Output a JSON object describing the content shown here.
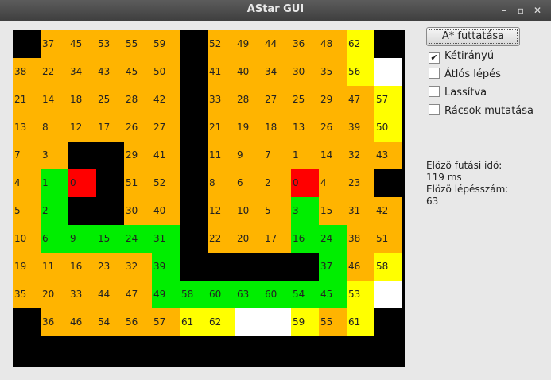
{
  "window": {
    "title": "AStar GUI",
    "buttons": {
      "minimize": "–",
      "maximize": "▫",
      "close": "✕"
    }
  },
  "controls": {
    "run_label": "A* futtatása",
    "options": [
      {
        "label": "Kétirányú",
        "checked": true
      },
      {
        "label": "Átlós lépés",
        "checked": false
      },
      {
        "label": "Lassítva",
        "checked": false
      },
      {
        "label": "Rácsok mutatása",
        "checked": false
      }
    ]
  },
  "info": {
    "time_label": "Elözö futási idö:",
    "time_value": "119 ms",
    "steps_label": "Elözö lépésszám:",
    "steps_value": "63"
  },
  "colors": {
    "wall": "#000000",
    "closed": "#ffb400",
    "open": "#ffff00",
    "path": "#00ee00",
    "endpoint": "#ff0000",
    "empty": "#ffffff"
  },
  "grid": {
    "legend": "K=wall O=closed Y=open G=path R=endpoint W=empty",
    "rows": [
      {
        "types": "KOOOOOKOOOOOYK",
        "values": [
          "",
          "37",
          "45",
          "53",
          "55",
          "59",
          "",
          "52",
          "49",
          "44",
          "36",
          "48",
          "62",
          ""
        ]
      },
      {
        "types": "OOOOOOKOOOOOYW",
        "values": [
          "38",
          "22",
          "34",
          "43",
          "45",
          "50",
          "",
          "41",
          "40",
          "34",
          "30",
          "35",
          "56",
          ""
        ]
      },
      {
        "types": "OOOOOOKOOOOOOY",
        "values": [
          "21",
          "14",
          "18",
          "25",
          "28",
          "42",
          "",
          "33",
          "28",
          "27",
          "25",
          "29",
          "47",
          "57"
        ]
      },
      {
        "types": "OOOOOOKOOOOOOY",
        "values": [
          "13",
          "8",
          "12",
          "17",
          "26",
          "27",
          "",
          "21",
          "19",
          "18",
          "13",
          "26",
          "39",
          "50"
        ]
      },
      {
        "types": "OOKKOOKOOOOOOO",
        "values": [
          "7",
          "3",
          "",
          "",
          "29",
          "41",
          "",
          "11",
          "9",
          "7",
          "1",
          "14",
          "32",
          "43"
        ]
      },
      {
        "types": "OGRKOOKOOOROOK",
        "values": [
          "4",
          "1",
          "0",
          "",
          "51",
          "52",
          "",
          "8",
          "6",
          "2",
          "0",
          "4",
          "23",
          ""
        ]
      },
      {
        "types": "OGKKOOKOOOGOOO",
        "values": [
          "5",
          "2",
          "",
          "",
          "30",
          "40",
          "",
          "12",
          "10",
          "5",
          "3",
          "15",
          "31",
          "42"
        ]
      },
      {
        "types": "OGGGGGKOOOGGOO",
        "values": [
          "10",
          "6",
          "9",
          "15",
          "24",
          "31",
          "",
          "22",
          "20",
          "17",
          "16",
          "24",
          "38",
          "51"
        ]
      },
      {
        "types": "OOOOOGKKKKKGOY",
        "values": [
          "19",
          "11",
          "16",
          "23",
          "32",
          "39",
          "",
          "",
          "",
          "",
          "",
          "37",
          "46",
          "58"
        ]
      },
      {
        "types": "OOOOOGGGGGGGYW",
        "values": [
          "35",
          "20",
          "33",
          "44",
          "47",
          "49",
          "58",
          "60",
          "63",
          "60",
          "54",
          "45",
          "53",
          ""
        ]
      },
      {
        "types": "KOOOOOYYWWYOYK",
        "values": [
          "",
          "36",
          "46",
          "54",
          "56",
          "57",
          "61",
          "62",
          "",
          "",
          "59",
          "55",
          "61",
          ""
        ]
      },
      {
        "types": "KKKKKKKKKKKKKK",
        "values": [
          "",
          "",
          "",
          "",
          "",
          "",
          "",
          "",
          "",
          "",
          "",
          "",
          "",
          ""
        ]
      }
    ]
  }
}
